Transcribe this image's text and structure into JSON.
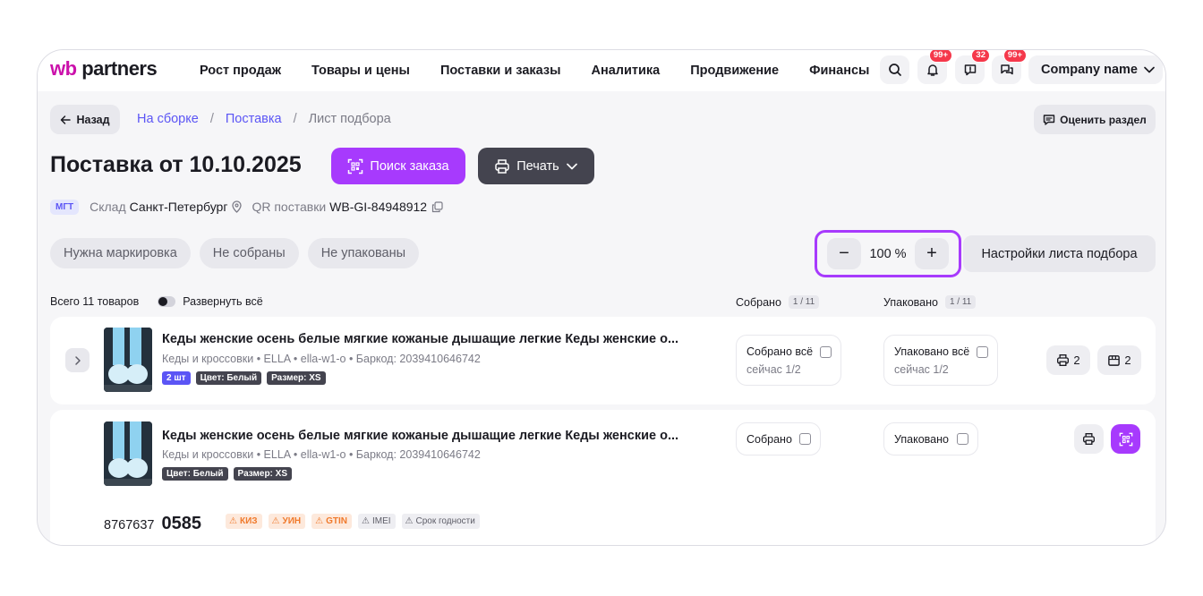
{
  "header": {
    "logo_wb": "wb",
    "logo_partners": "partners",
    "nav": [
      "Рост продаж",
      "Товары и цены",
      "Поставки и заказы",
      "Аналитика",
      "Продвижение",
      "Финансы"
    ],
    "badges": {
      "notifications": "99+",
      "feedback": "32",
      "chats": "99+"
    },
    "company": "Company name"
  },
  "breadcrumb": {
    "back": "Назад",
    "items": [
      "На сборке",
      "Поставка",
      "Лист подбора"
    ],
    "separator": "/"
  },
  "rate_button": "Оценить раздел",
  "title": "Поставка от 10.10.2025",
  "buttons": {
    "search_order": "Поиск заказа",
    "print": "Печать"
  },
  "meta": {
    "tag": "МГТ",
    "warehouse_label": "Склад",
    "warehouse_value": "Санкт-Петербург",
    "qr_label": "QR поставки",
    "qr_value": "WB-GI-84948912"
  },
  "filters": [
    "Нужна маркировка",
    "Не собраны",
    "Не упакованы"
  ],
  "zoom": {
    "value": "100 %",
    "minus": "−",
    "plus": "+"
  },
  "settings_button": "Настройки листа подбора",
  "list": {
    "total": "Всего 11 товаров",
    "expand_all": "Развернуть всё",
    "collected_header": "Собрано",
    "collected_count": "1 / 11",
    "packed_header": "Упаковано",
    "packed_count": "1 / 11"
  },
  "items": [
    {
      "title": "Кеды женские осень белые мягкие кожаные дышащие легкие Кеды женские о...",
      "subtitle": "Кеды и кроссовки • ELLA • ella-w1-o • Баркод: 2039410646742",
      "tags": [
        "2 шт",
        "Цвет: Белый",
        "Размер: XS"
      ],
      "collected_label": "Собрано всё",
      "collected_now": "сейчас 1/2",
      "packed_label": "Упаковано всё",
      "packed_now": "сейчас 1/2",
      "print_count": "2",
      "box_count": "2"
    },
    {
      "title": "Кеды женские осень белые мягкие кожаные дышащие легкие Кеды женские о...",
      "subtitle": "Кеды и кроссовки • ELLA • ella-w1-o • Баркод: 2039410646742",
      "tags": [
        "Цвет: Белый",
        "Размер: XS"
      ],
      "collected_label": "Собрано",
      "packed_label": "Упаковано",
      "barcode_prefix": "8767637",
      "barcode_main": "0585",
      "warnings": [
        "КИЗ",
        "УИН",
        "GTIN",
        "IMEI",
        "Срок годности"
      ]
    }
  ],
  "colors": {
    "accent_purple": "#a73afd",
    "link_blue": "#5b55f5",
    "badge_red": "#f5384b",
    "warn_orange": "#f07a2c"
  }
}
